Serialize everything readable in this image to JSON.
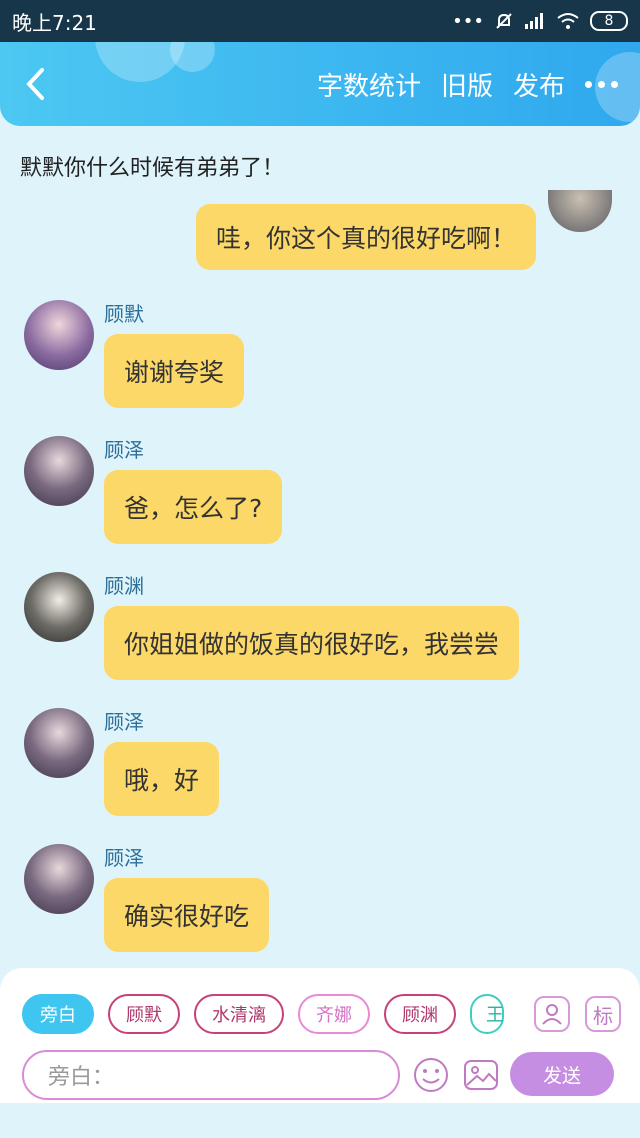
{
  "status_bar": {
    "time": "晚上7:21",
    "battery": "8"
  },
  "header": {
    "actions": [
      "字数统计",
      "旧版",
      "发布"
    ]
  },
  "narration": "默默你什么时候有弟弟了！",
  "self_message": "哇，你这个真的很好吃啊！",
  "messages": [
    {
      "name": "顾默",
      "text": "谢谢夸奖"
    },
    {
      "name": "顾泽",
      "text": "爸，怎么了?"
    },
    {
      "name": "顾渊",
      "text": "你姐姐做的饭真的很好吃，我尝尝"
    },
    {
      "name": "顾泽",
      "text": "哦，好"
    },
    {
      "name": "顾泽",
      "text": "确实很好吃"
    }
  ],
  "roles": [
    "旁白",
    "顾默",
    "水清漓",
    "齐娜",
    "顾渊",
    "王"
  ],
  "tools": {
    "mark_label": "标"
  },
  "input": {
    "placeholder": "旁白："
  },
  "send_label": "发送",
  "colors": {
    "header": "#2fa8ee",
    "bubble": "#fcd868",
    "send": "#c58ee3",
    "background": "#dff3fa"
  }
}
